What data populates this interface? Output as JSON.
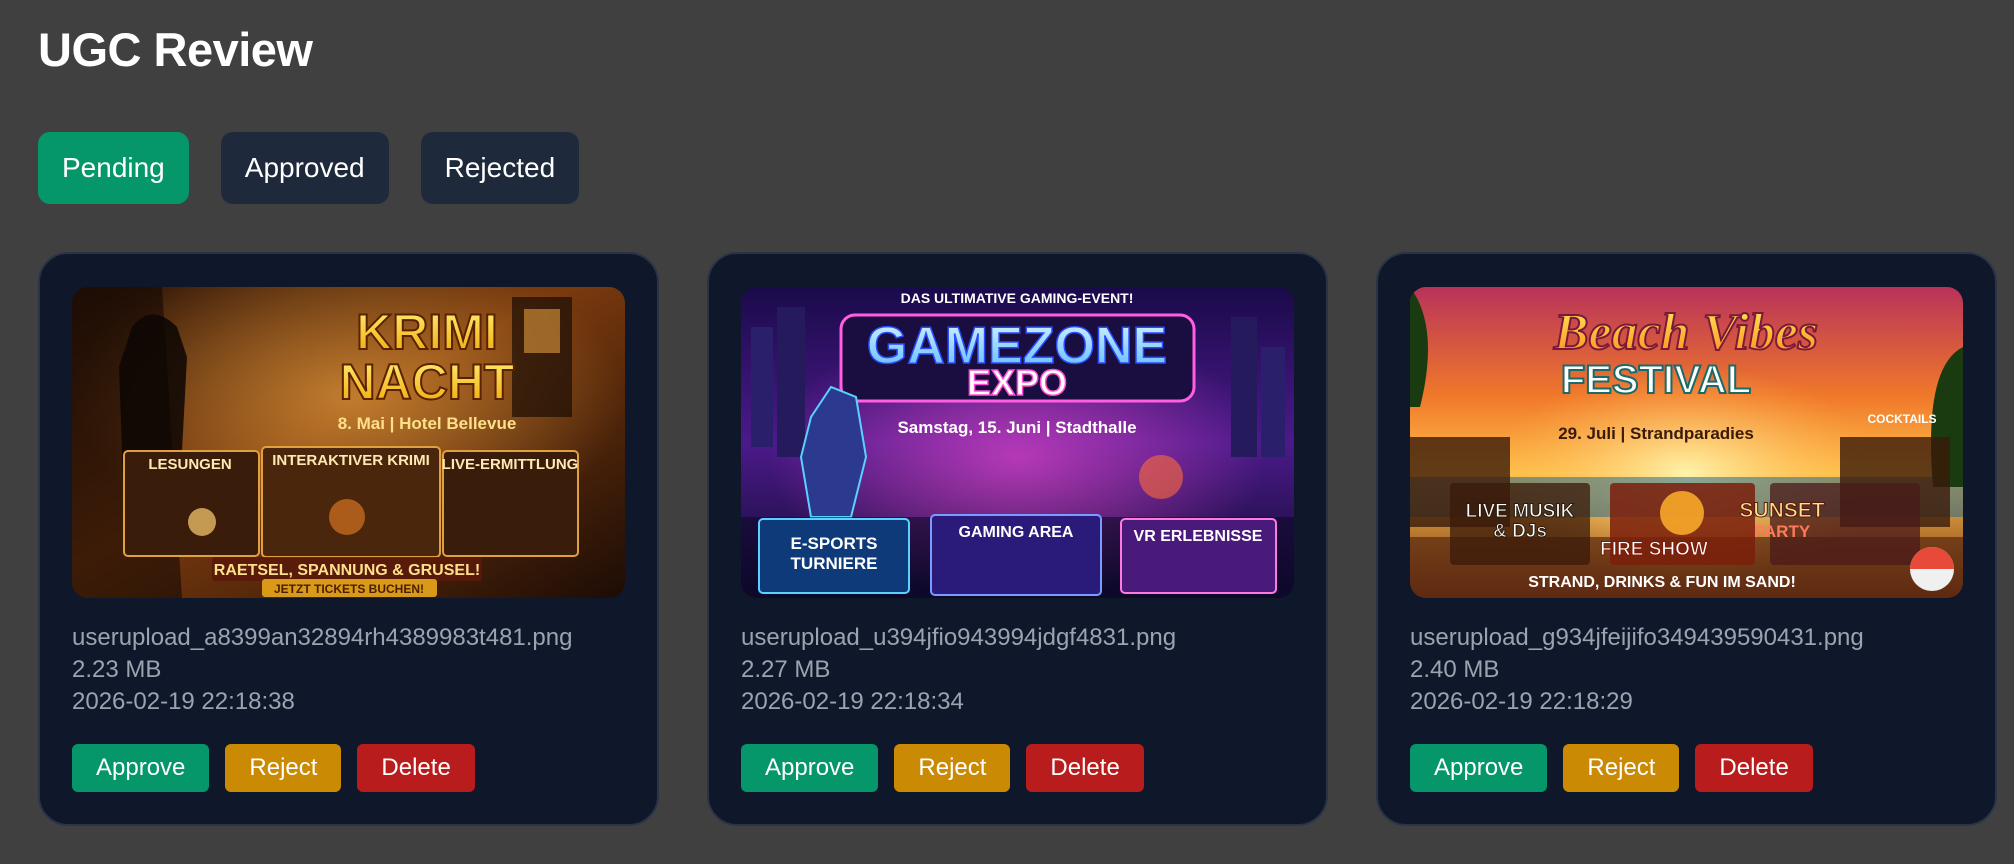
{
  "page": {
    "title": "UGC Review"
  },
  "tabs": [
    {
      "label": "Pending",
      "active": true
    },
    {
      "label": "Approved",
      "active": false
    },
    {
      "label": "Rejected",
      "active": false
    }
  ],
  "cards": [
    {
      "filename": "userupload_a8399an32894rh4389983t481.png",
      "size": "2.23 MB",
      "timestamp": "2026-02-19 22:18:38",
      "poster": {
        "title_line1": "KRIMI",
        "title_line2": "NACHT",
        "subtitle": "8. Mai | Hotel Bellevue",
        "panel1": "LESUNGEN",
        "panel2": "INTERAKTIVER KRIMI",
        "panel3": "LIVE-ERMITTLUNG",
        "tagline": "RAETSEL, SPANNUNG & GRUSEL!",
        "cta": "JETZT TICKETS BUCHEN!"
      },
      "actions": {
        "approve": "Approve",
        "reject": "Reject",
        "delete": "Delete"
      }
    },
    {
      "filename": "userupload_u394jfio943994jdgf4831.png",
      "size": "2.27 MB",
      "timestamp": "2026-02-19 22:18:34",
      "poster": {
        "kicker": "DAS ULTIMATIVE GAMING-EVENT!",
        "title_line1": "GAMEZONE",
        "title_line2": "EXPO",
        "subtitle": "Samstag, 15. Juni | Stadthalle",
        "panel1_line1": "E-SPORTS",
        "panel1_line2": "TURNIERE",
        "panel2": "GAMING AREA",
        "panel3": "VR ERLEBNISSE"
      },
      "actions": {
        "approve": "Approve",
        "reject": "Reject",
        "delete": "Delete"
      }
    },
    {
      "filename": "userupload_g934jfeijifo349439590431.png",
      "size": "2.40 MB",
      "timestamp": "2026-02-19 22:18:29",
      "poster": {
        "title_line1": "Beach Vibes",
        "title_line2": "FESTIVAL",
        "subtitle": "29. Juli | Strandparadies",
        "corner": "COCKTAILS",
        "panel1_line1": "LIVE MUSIK",
        "panel1_line2": "& DJs",
        "panel2": "FIRE SHOW",
        "panel3_line1": "SUNSET",
        "panel3_line2": "PARTY",
        "tagline": "STRAND, DRINKS & FUN IM SAND!"
      },
      "actions": {
        "approve": "Approve",
        "reject": "Reject",
        "delete": "Delete"
      }
    }
  ]
}
